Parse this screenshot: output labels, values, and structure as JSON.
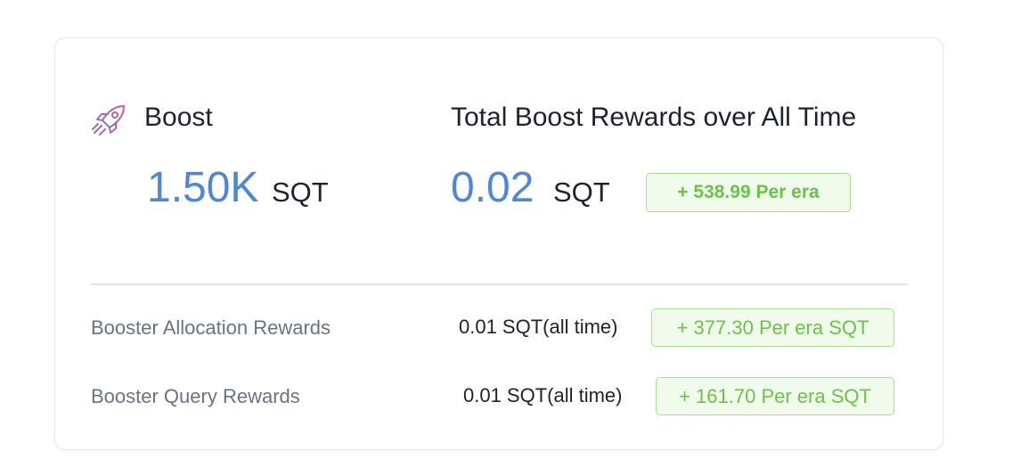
{
  "boost": {
    "icon": "rocket-icon",
    "title": "Boost",
    "value": "1.50K",
    "unit": "SQT"
  },
  "total_rewards": {
    "title": "Total Boost Rewards over All Time",
    "value": "0.02",
    "unit": "SQT",
    "badge": "+ 538.99 Per era"
  },
  "rows": [
    {
      "label": "Booster Allocation Rewards",
      "value": "0.01 SQT(all time)",
      "badge": "+ 377.30 Per era SQT"
    },
    {
      "label": "Booster Query Rewards",
      "value": "0.01 SQT(all time)",
      "badge": "+ 161.70 Per era SQT"
    }
  ],
  "colors": {
    "accent_blue": "#4f86d6",
    "badge_green": "#6cc24a",
    "badge_bg": "#f1fbec",
    "badge_border": "#a8dc95",
    "rocket_gradient": [
      "#6b7fe6",
      "#e2567a"
    ]
  }
}
